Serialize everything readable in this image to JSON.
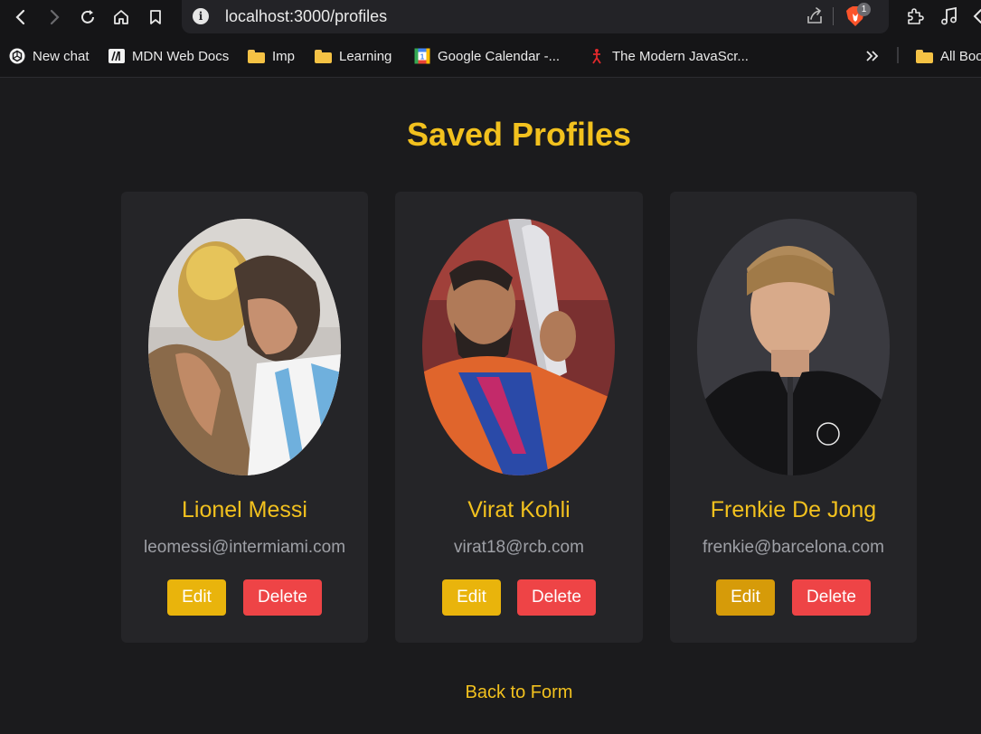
{
  "browser": {
    "url": "localhost:3000/profiles",
    "shields_badge": "1",
    "bookmarks": [
      {
        "label": "New chat",
        "icon": "openai-icon"
      },
      {
        "label": "MDN Web Docs",
        "icon": "mdn-icon"
      },
      {
        "label": "Imp",
        "icon": "folder-icon"
      },
      {
        "label": "Learning",
        "icon": "folder-icon"
      },
      {
        "label": "Google Calendar -...",
        "icon": "google-calendar-icon"
      },
      {
        "label": "The Modern JavaScr...",
        "icon": "javascript-info-icon"
      },
      {
        "label": "All Boo",
        "icon": "folder-icon"
      }
    ]
  },
  "page": {
    "title": "Saved Profiles",
    "back_link": "Back to Form",
    "edit_label": "Edit",
    "delete_label": "Delete"
  },
  "profiles": [
    {
      "name": "Lionel Messi",
      "email": "leomessi@intermiami.com"
    },
    {
      "name": "Virat Kohli",
      "email": "virat18@rcb.com"
    },
    {
      "name": "Frenkie De Jong",
      "email": "frenkie@barcelona.com"
    }
  ],
  "colors": {
    "accent": "#f2c11e",
    "edit_button": "#e9b40c",
    "delete_button": "#ee4446",
    "background": "#1b1b1d",
    "card": "#252528"
  }
}
